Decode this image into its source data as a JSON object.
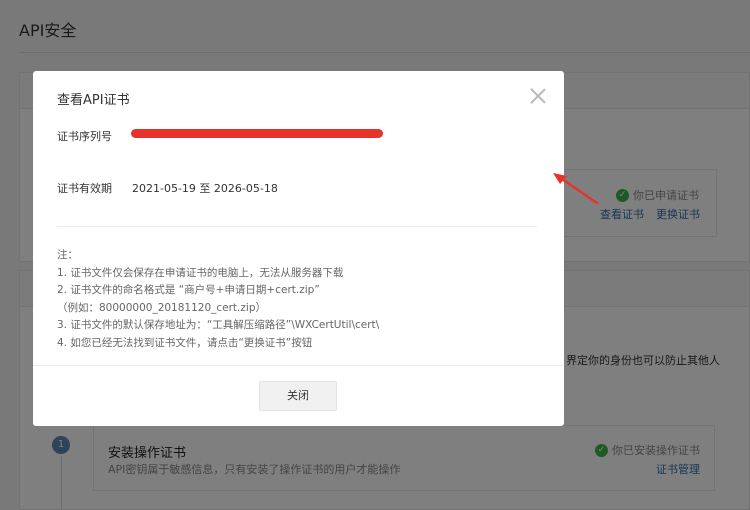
{
  "page": {
    "title": "API安全",
    "cert_card": {
      "status": "你已申请证书",
      "view_link": "查看证书",
      "replace_link": "更换证书"
    },
    "partial_text": "界定你的身份也可以防止其他人",
    "operation_cert": {
      "step": "1",
      "title": "安装操作证书",
      "desc": "API密钥属于敏感信息，只有安装了操作证书的用户才能操作",
      "status": "你已安装操作证书",
      "manage_link": "证书管理"
    }
  },
  "modal": {
    "title": "查看API证书",
    "serial_label": "证书序列号",
    "validity_label": "证书有效期",
    "validity_value": "2021-05-19 至 2026-05-18",
    "notes": [
      "注：",
      "1. 证书文件仅会保存在申请证书的电脑上，无法从服务器下载",
      "2. 证书文件的命名格式是 “商户号+申请日期+cert.zip”",
      "（例如：80000000_20181120_cert.zip）",
      "3. 证书文件的默认保存地址为：“工具解压缩路径”\\WXCertUtil\\cert\\",
      "4. 如您已经无法找到证书文件，请点击“更换证书”按钮"
    ],
    "close_label": "关闭"
  },
  "colors": {
    "link": "#2e6ea8",
    "success": "#3bb44a",
    "redaction": "#e8332a",
    "arrow": "#e8332a"
  }
}
